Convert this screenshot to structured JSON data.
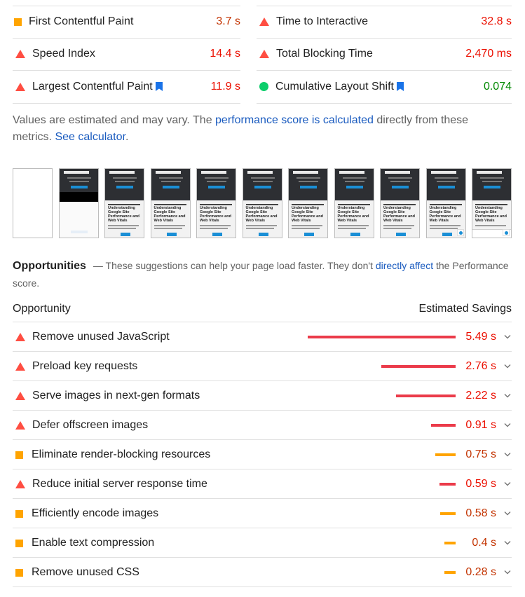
{
  "metrics": {
    "left": [
      {
        "label": "First Contentful Paint",
        "value": "3.7 s",
        "status": "average",
        "icon": "orange-square-icon",
        "bookmark": false
      },
      {
        "label": "Speed Index",
        "value": "14.4 s",
        "status": "fail",
        "icon": "red-triangle-icon",
        "bookmark": false
      },
      {
        "label": "Largest Contentful Paint",
        "value": "11.9 s",
        "status": "fail",
        "icon": "red-triangle-icon",
        "bookmark": true
      }
    ],
    "right": [
      {
        "label": "Time to Interactive",
        "value": "32.8 s",
        "status": "fail",
        "icon": "red-triangle-icon",
        "bookmark": false
      },
      {
        "label": "Total Blocking Time",
        "value": "2,470 ms",
        "status": "fail",
        "icon": "red-triangle-icon",
        "bookmark": false
      },
      {
        "label": "Cumulative Layout Shift",
        "value": "0.074",
        "status": "pass",
        "icon": "green-circle-icon",
        "bookmark": true
      }
    ]
  },
  "note": {
    "prefix": "Values are estimated and may vary. The ",
    "link1": "performance score is calculated",
    "middle": " directly from these metrics. ",
    "link2": "See calculator",
    "suffix": "."
  },
  "filmstrip": {
    "frame_heading": "Understanding Google Site Performance and Web Vitals"
  },
  "opportunities": {
    "title": "Opportunities",
    "desc_prefix": "— These suggestions can help your page load faster. They don't ",
    "desc_link": "directly affect",
    "desc_suffix": " the Performance score.",
    "col_opportunity": "Opportunity",
    "col_savings": "Estimated Savings",
    "items": [
      {
        "label": "Remove unused JavaScript",
        "value": "5.49 s",
        "seconds": 5.49,
        "status": "fail"
      },
      {
        "label": "Preload key requests",
        "value": "2.76 s",
        "seconds": 2.76,
        "status": "fail"
      },
      {
        "label": "Serve images in next-gen formats",
        "value": "2.22 s",
        "seconds": 2.22,
        "status": "fail"
      },
      {
        "label": "Defer offscreen images",
        "value": "0.91 s",
        "seconds": 0.91,
        "status": "fail"
      },
      {
        "label": "Eliminate render-blocking resources",
        "value": "0.75 s",
        "seconds": 0.75,
        "status": "average"
      },
      {
        "label": "Reduce initial server response time",
        "value": "0.59 s",
        "seconds": 0.59,
        "status": "fail"
      },
      {
        "label": "Efficiently encode images",
        "value": "0.58 s",
        "seconds": 0.58,
        "status": "average"
      },
      {
        "label": "Enable text compression",
        "value": "0.4 s",
        "seconds": 0.4,
        "status": "average"
      },
      {
        "label": "Remove unused CSS",
        "value": "0.28 s",
        "seconds": 0.28,
        "status": "average"
      }
    ]
  },
  "colors": {
    "fail": "#eb0f00",
    "average": "#c33300",
    "pass": "#008800",
    "fail_bar": "#eb3b4a",
    "average_bar": "#ffa400",
    "link": "#1a5bbf"
  }
}
